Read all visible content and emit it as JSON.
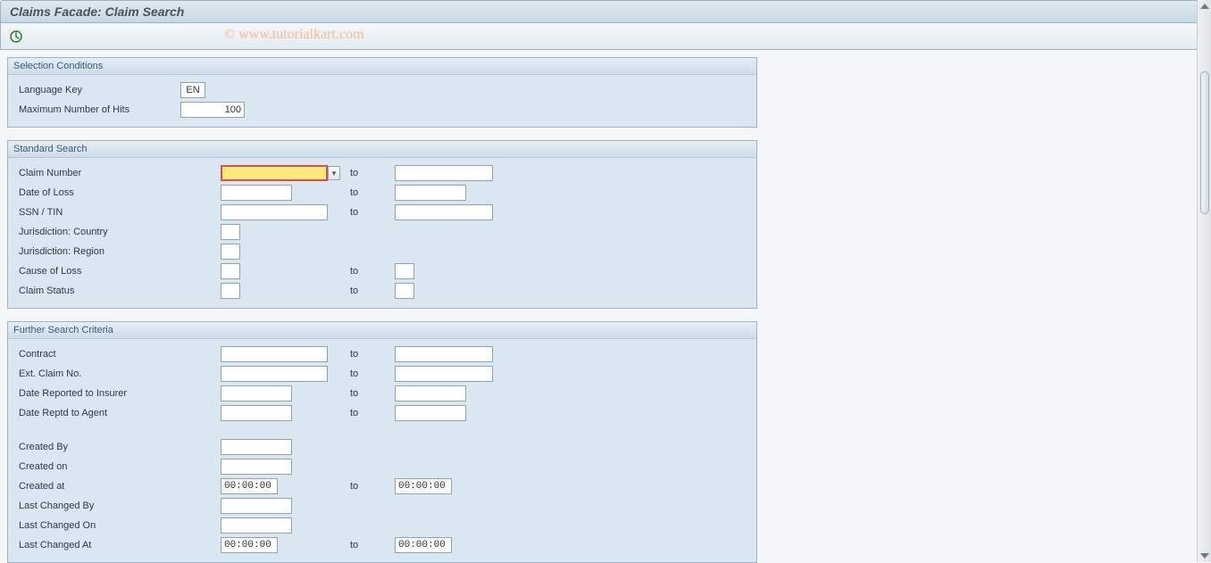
{
  "header": {
    "title": "Claims Facade: Claim Search"
  },
  "watermark": "© www.tutorialkart.com",
  "selection": {
    "title": "Selection Conditions",
    "language_label": "Language Key",
    "language_value": "EN",
    "maxhits_label": "Maximum Number of Hits",
    "maxhits_value": "100"
  },
  "standard": {
    "title": "Standard Search",
    "to": "to",
    "claim_number": "Claim Number",
    "date_of_loss": "Date of Loss",
    "ssn_tin": "SSN / TIN",
    "juris_country": "Jurisdiction: Country",
    "juris_region": "Jurisdiction: Region",
    "cause_of_loss": "Cause of Loss",
    "claim_status": "Claim Status"
  },
  "further": {
    "title": "Further Search Criteria",
    "to": "to",
    "contract": "Contract",
    "ext_claim": "Ext. Claim No.",
    "date_reported_insurer": "Date Reported to Insurer",
    "date_reptd_agent": "Date Reptd to Agent",
    "created_by": "Created By",
    "created_on": "Created on",
    "created_at": "Created at",
    "created_at_value": "00:00:00",
    "created_at_to_value": "00:00:00",
    "last_changed_by": "Last Changed By",
    "last_changed_on": "Last Changed On",
    "last_changed_at": "Last Changed At",
    "last_changed_at_value": "00:00:00",
    "last_changed_at_to_value": "00:00:00"
  }
}
